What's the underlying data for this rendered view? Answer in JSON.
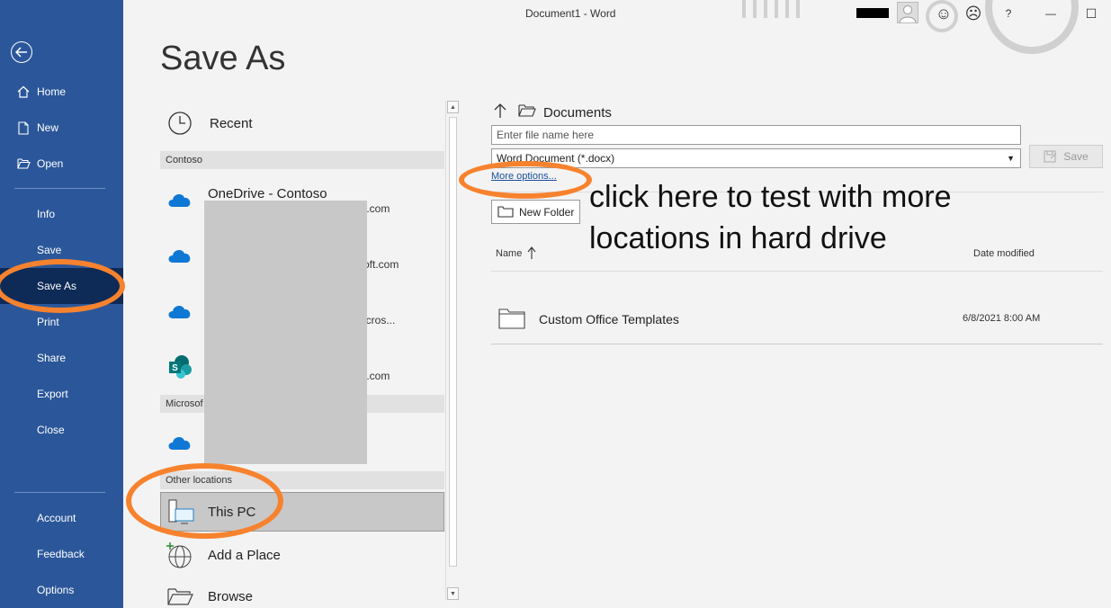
{
  "window": {
    "title": "Document1  -  Word"
  },
  "titlebar": {
    "smile": "☺",
    "frown": "☹",
    "help": "?",
    "minimize": "—",
    "maximize": "☐"
  },
  "sidebar": {
    "home": "Home",
    "new": "New",
    "open": "Open",
    "info": "Info",
    "save": "Save",
    "save_as": "Save As",
    "print": "Print",
    "share": "Share",
    "export": "Export",
    "close": "Close",
    "account": "Account",
    "feedback": "Feedback",
    "options": "Options"
  },
  "page": {
    "title": "Save As"
  },
  "locations": {
    "recent": "Recent",
    "group_contoso": "Contoso",
    "onedrive_contoso": "OneDrive - Contoso",
    "onedrive_contoso_sub": "t.com",
    "site2_sub": "oft.com",
    "site3_sub": "icros...",
    "sharepoint_sub": "t.com",
    "group_microsoft": "Microsof",
    "group_other": "Other locations",
    "this_pc": "This PC",
    "add_place": "Add a Place",
    "browse": "Browse"
  },
  "browser": {
    "path": "Documents",
    "filename_placeholder": "Enter file name here",
    "filetype": "Word Document (*.docx)",
    "save_label": "Save",
    "more_options": "More options...",
    "new_folder": "New Folder",
    "col_name": "Name",
    "col_date": "Date modified",
    "files": [
      {
        "name": "Custom Office Templates",
        "date": "6/8/2021 8:00 AM"
      }
    ]
  },
  "annotation": {
    "line1": "click here to test with more",
    "line2": "locations in hard drive"
  },
  "colors": {
    "sidebar": "#2b579a",
    "active": "#0e2a56",
    "highlight": "#f7822e"
  }
}
